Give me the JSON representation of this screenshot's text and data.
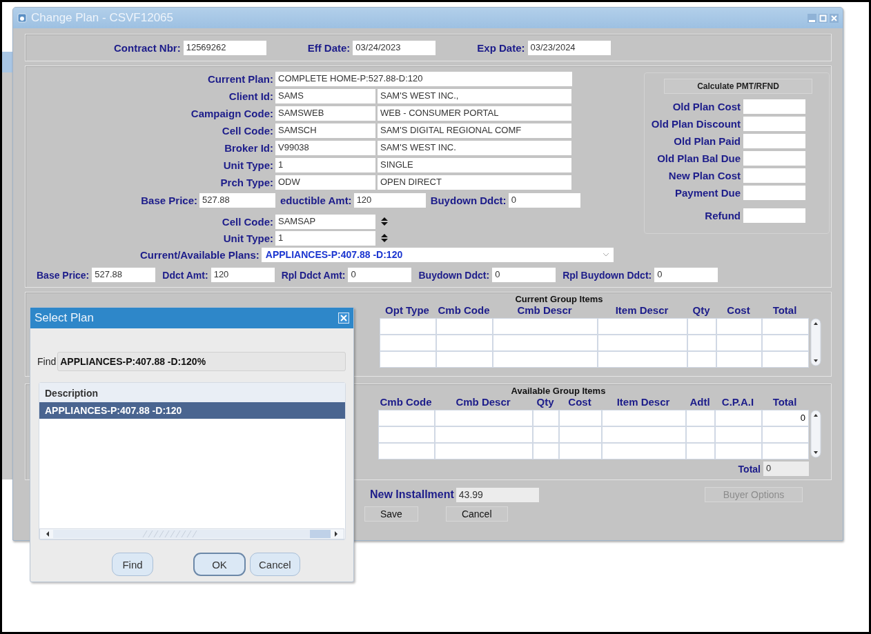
{
  "window": {
    "title": "Change Plan - CSVF12065"
  },
  "header_fields": [
    {
      "label": "Contract Nbr:",
      "value": "12569262"
    },
    {
      "label": "Eff Date:",
      "value": "03/24/2023"
    },
    {
      "label": "Exp Date:",
      "value": "03/23/2024"
    }
  ],
  "plan_fields": [
    {
      "label": "Current Plan:",
      "value": "COMPLETE HOME-P:527.88-D:120"
    },
    {
      "label": "Client Id:",
      "value": "SAMS",
      "description": "SAM'S WEST INC.,"
    },
    {
      "label": "Campaign Code:",
      "value": "SAMSWEB",
      "description": "WEB - CONSUMER PORTAL"
    },
    {
      "label": "Cell Code:",
      "value": "SAMSCH",
      "description": "SAM'S DIGITAL REGIONAL   COMF"
    },
    {
      "label": "Broker Id:",
      "value": "V99038",
      "description": "SAM'S WEST INC."
    },
    {
      "label": "Unit Type:",
      "value": "1",
      "description": "SINGLE"
    },
    {
      "label": "Prch Type:",
      "value": "ODW",
      "description": "OPEN DIRECT"
    }
  ],
  "price_row": [
    {
      "label": "Base Price:",
      "value": "527.88"
    },
    {
      "label": "eductible Amt:",
      "value": "120"
    },
    {
      "label": "Buydown Ddct:",
      "value": "0"
    }
  ],
  "selectors": [
    {
      "label": "Cell Code:",
      "value": "SAMSAP",
      "kind": "spinner"
    },
    {
      "label": "Unit Type:",
      "value": "1",
      "kind": "spinner"
    },
    {
      "label": "Current/Available Plans:",
      "value": "APPLIANCES-P:407.88 -D:120",
      "kind": "dropdown"
    }
  ],
  "amounts_row": [
    {
      "label": "Base Price:",
      "value": "527.88"
    },
    {
      "label": "Ddct Amt:",
      "value": "120"
    },
    {
      "label": "Rpl Ddct Amt:",
      "value": "0"
    },
    {
      "label": "Buydown Ddct:",
      "value": "0"
    },
    {
      "label": "Rpl Buydown Ddct:",
      "value": "0"
    }
  ],
  "calculator": {
    "button": "Calculate PMT/RFND",
    "fields": [
      {
        "label": "Old Plan Cost"
      },
      {
        "label": "Old Plan Discount"
      },
      {
        "label": "Old Plan Paid"
      },
      {
        "label": "Old Plan Bal Due"
      },
      {
        "label": "New Plan Cost"
      },
      {
        "label": "Payment Due"
      },
      {
        "label": "Refund"
      }
    ]
  },
  "current_group_items": {
    "title": "Current Group Items",
    "columns": [
      "Opt Type",
      "Cmb Code",
      "Cmb Descr",
      "Item Descr",
      "Qty",
      "Cost",
      "Total"
    ],
    "rows": [
      {},
      {},
      {}
    ]
  },
  "available_group_items": {
    "title": "Available Group Items",
    "columns": [
      "Cmb Code",
      "Cmb Descr",
      "Qty",
      "Cost",
      "Item Descr",
      "Adtl",
      "C.P.A.I",
      "Total"
    ],
    "rows": [
      {
        "total": "0"
      },
      {},
      {}
    ],
    "total": {
      "label": "Total",
      "value": "0"
    }
  },
  "installment": {
    "label": "New Installment",
    "value": "43.99"
  },
  "buyer_options": {
    "label": "Buyer Options",
    "disabled": true
  },
  "buttons": [
    "Save",
    "Cancel"
  ],
  "select_plan": {
    "title": "Select Plan",
    "find_label": "Find",
    "find_value": "APPLIANCES-P:407.88 -D:120%",
    "column": "Description",
    "items": [
      {
        "text": "APPLIANCES-P:407.88 -D:120",
        "selected": true
      }
    ],
    "buttons": [
      {
        "label": "Find",
        "default": false
      },
      {
        "label": "OK",
        "default": true
      },
      {
        "label": "Cancel",
        "default": false
      }
    ]
  }
}
